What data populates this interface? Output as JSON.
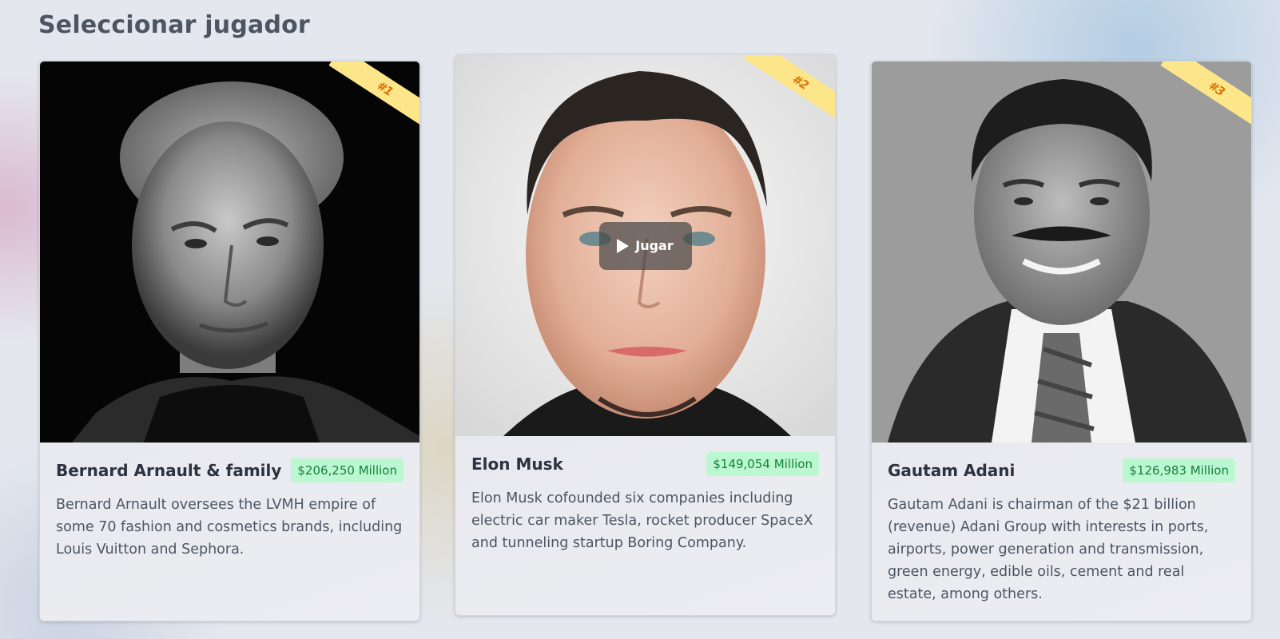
{
  "page": {
    "title": "Seleccionar jugador"
  },
  "play_label": "Jugar",
  "players": [
    {
      "rank": "#1",
      "name": "Bernard Arnault & family",
      "wealth": "$206,250 Million",
      "description": "Bernard Arnault oversees the LVMH empire of some 70 fashion and cosmetics brands, including Louis Vuitton and Sephora."
    },
    {
      "rank": "#2",
      "name": "Elon Musk",
      "wealth": "$149,054 Million",
      "description": "Elon Musk cofounded six companies including electric car maker Tesla, rocket producer SpaceX and tunneling startup Boring Company."
    },
    {
      "rank": "#3",
      "name": "Gautam Adani",
      "wealth": "$126,983 Million",
      "description": "Gautam Adani is chairman of the $21 billion (revenue) Adani Group with interests in ports, airports, power generation and transmission, green energy, edible oils, cement and real estate, among others."
    }
  ],
  "colors": {
    "ribbon": "#fde68a",
    "ribbon_text": "#d97706",
    "wealth_badge_bg": "#bbf7d0",
    "wealth_badge_text": "#15803d"
  }
}
